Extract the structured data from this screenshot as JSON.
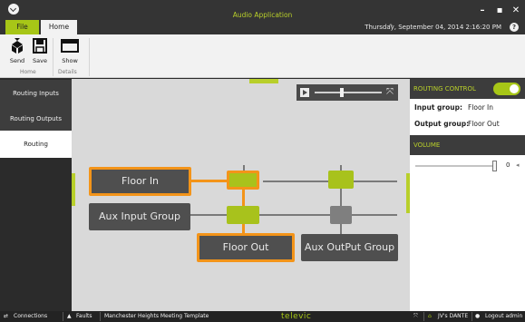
{
  "window": {
    "title": "Audio Application",
    "controls": {
      "minimize": "–",
      "maximize": "▪",
      "close": "✕"
    }
  },
  "tabs": [
    {
      "label": "File",
      "active": false
    },
    {
      "label": "Home",
      "active": true
    }
  ],
  "datetime": "Thursday, September 04, 2014 2:16:20 PM",
  "help": "?",
  "ribbon": {
    "groups": [
      {
        "label": "Home",
        "buttons": [
          {
            "label": "Send",
            "icon": "send-icon"
          },
          {
            "label": "Save",
            "icon": "save-icon"
          }
        ]
      },
      {
        "label": "Details",
        "buttons": [
          {
            "label": "Show",
            "icon": "show-icon"
          }
        ]
      }
    ]
  },
  "sidebar": {
    "items": [
      {
        "label": "Routing Inputs",
        "active": false
      },
      {
        "label": "Routing Outputs",
        "active": false
      },
      {
        "label": "Routing",
        "active": true
      }
    ]
  },
  "routing": {
    "inputs": [
      {
        "label": "Floor In",
        "selected": true
      },
      {
        "label": "Aux Input Group",
        "selected": false
      }
    ],
    "outputs": [
      {
        "label": "Floor Out",
        "selected": true
      },
      {
        "label": "Aux OutPut Group",
        "selected": false
      }
    ],
    "zoom_level": 0.58
  },
  "routing_control": {
    "title": "ROUTING CONTROL",
    "enabled": true,
    "input_group_label": "Input group:",
    "input_group_value": "Floor In",
    "output_group_label": "Output group:",
    "output_group_value": "Floor Out"
  },
  "volume": {
    "title": "VOLUME",
    "value": "0",
    "level": 1.0
  },
  "statusbar": {
    "connections": "Connections",
    "faults": "Faults",
    "template": "Manchester Heights Meeting Template",
    "brand": "televic",
    "user_dante": "JV's DANTE",
    "logout": "Logout admin"
  },
  "colors": {
    "accent": "#a7c617",
    "selection": "#f39419",
    "dark": "#343434"
  }
}
